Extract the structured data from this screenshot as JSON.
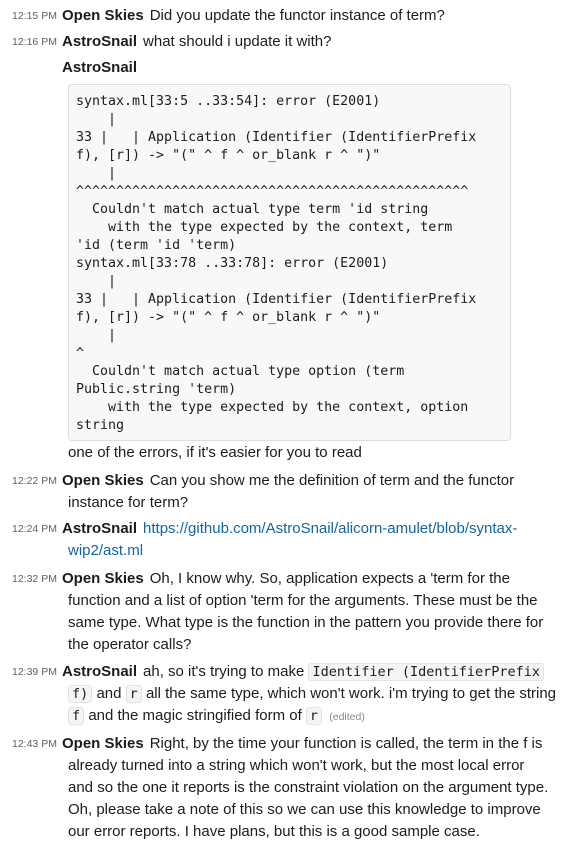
{
  "messages": [
    {
      "time": "12:15 PM",
      "author": "Open Skies",
      "text": "Did you update the functor instance of term?"
    },
    {
      "time": "12:16 PM",
      "author": "AstroSnail",
      "text": "what should i update it with?"
    },
    {
      "author": "AstroSnail",
      "code": "syntax.ml[33:5 ..33:54]: error (E2001)\n    |\n33 |   | Application (Identifier (IdentifierPrefix\nf), [r]) -> \"(\" ^ f ^ or_blank r ^ \")\"\n    |\n^^^^^^^^^^^^^^^^^^^^^^^^^^^^^^^^^^^^^^^^^^^^^^^^^\n  Couldn't match actual type term 'id string\n    with the type expected by the context, term\n'id (term 'id 'term)\nsyntax.ml[33:78 ..33:78]: error (E2001)\n    |\n33 |   | Application (Identifier (IdentifierPrefix\nf), [r]) -> \"(\" ^ f ^ or_blank r ^ \")\"\n    |\n^\n  Couldn't match actual type option (term\nPublic.string 'term)\n    with the type expected by the context, option\nstring",
      "after": "one of the errors, if it's easier for you to read"
    },
    {
      "time": "12:22 PM",
      "author": "Open Skies",
      "line1": "Can you show me the definition of term and the functor",
      "line2": "instance for term?"
    },
    {
      "time": "12:24 PM",
      "author": "AstroSnail",
      "link1": "https://github.com/AstroSnail/alicorn-amulet/blob/syntax-",
      "link2": "wip2/ast.ml"
    },
    {
      "time": "12:32 PM",
      "author": "Open Skies",
      "line1": "Oh, I know why. So, application expects a 'term for the",
      "line2": "function and a list of option 'term for the arguments. These must be the",
      "line3": "same type. What type is the function in the pattern you provide there for",
      "line4": "the operator calls?"
    },
    {
      "time": "12:39 PM",
      "author": "AstroSnail",
      "t1": "ah, so it's trying to make",
      "c1": "Identifier (IdentifierPrefix",
      "c2": "f)",
      "t2": "and",
      "c3": "r",
      "t3": "all the same type, which won't work. i'm trying to get the string",
      "c4": "f",
      "t4": "and the magic stringified form of",
      "c5": "r",
      "edited": "(edited)"
    },
    {
      "time": "12:43 PM",
      "author": "Open Skies",
      "line1": "Right, by the time your function is called, the term in the f is",
      "line2": "already turned into a string which won't work, but the most local error",
      "line3": "and so the one it reports is the constraint violation on the argument type.",
      "line4": "Oh, please take a note of this so we can use this knowledge to improve",
      "line5": "our error reports. I have plans, but this is a good sample case."
    }
  ]
}
